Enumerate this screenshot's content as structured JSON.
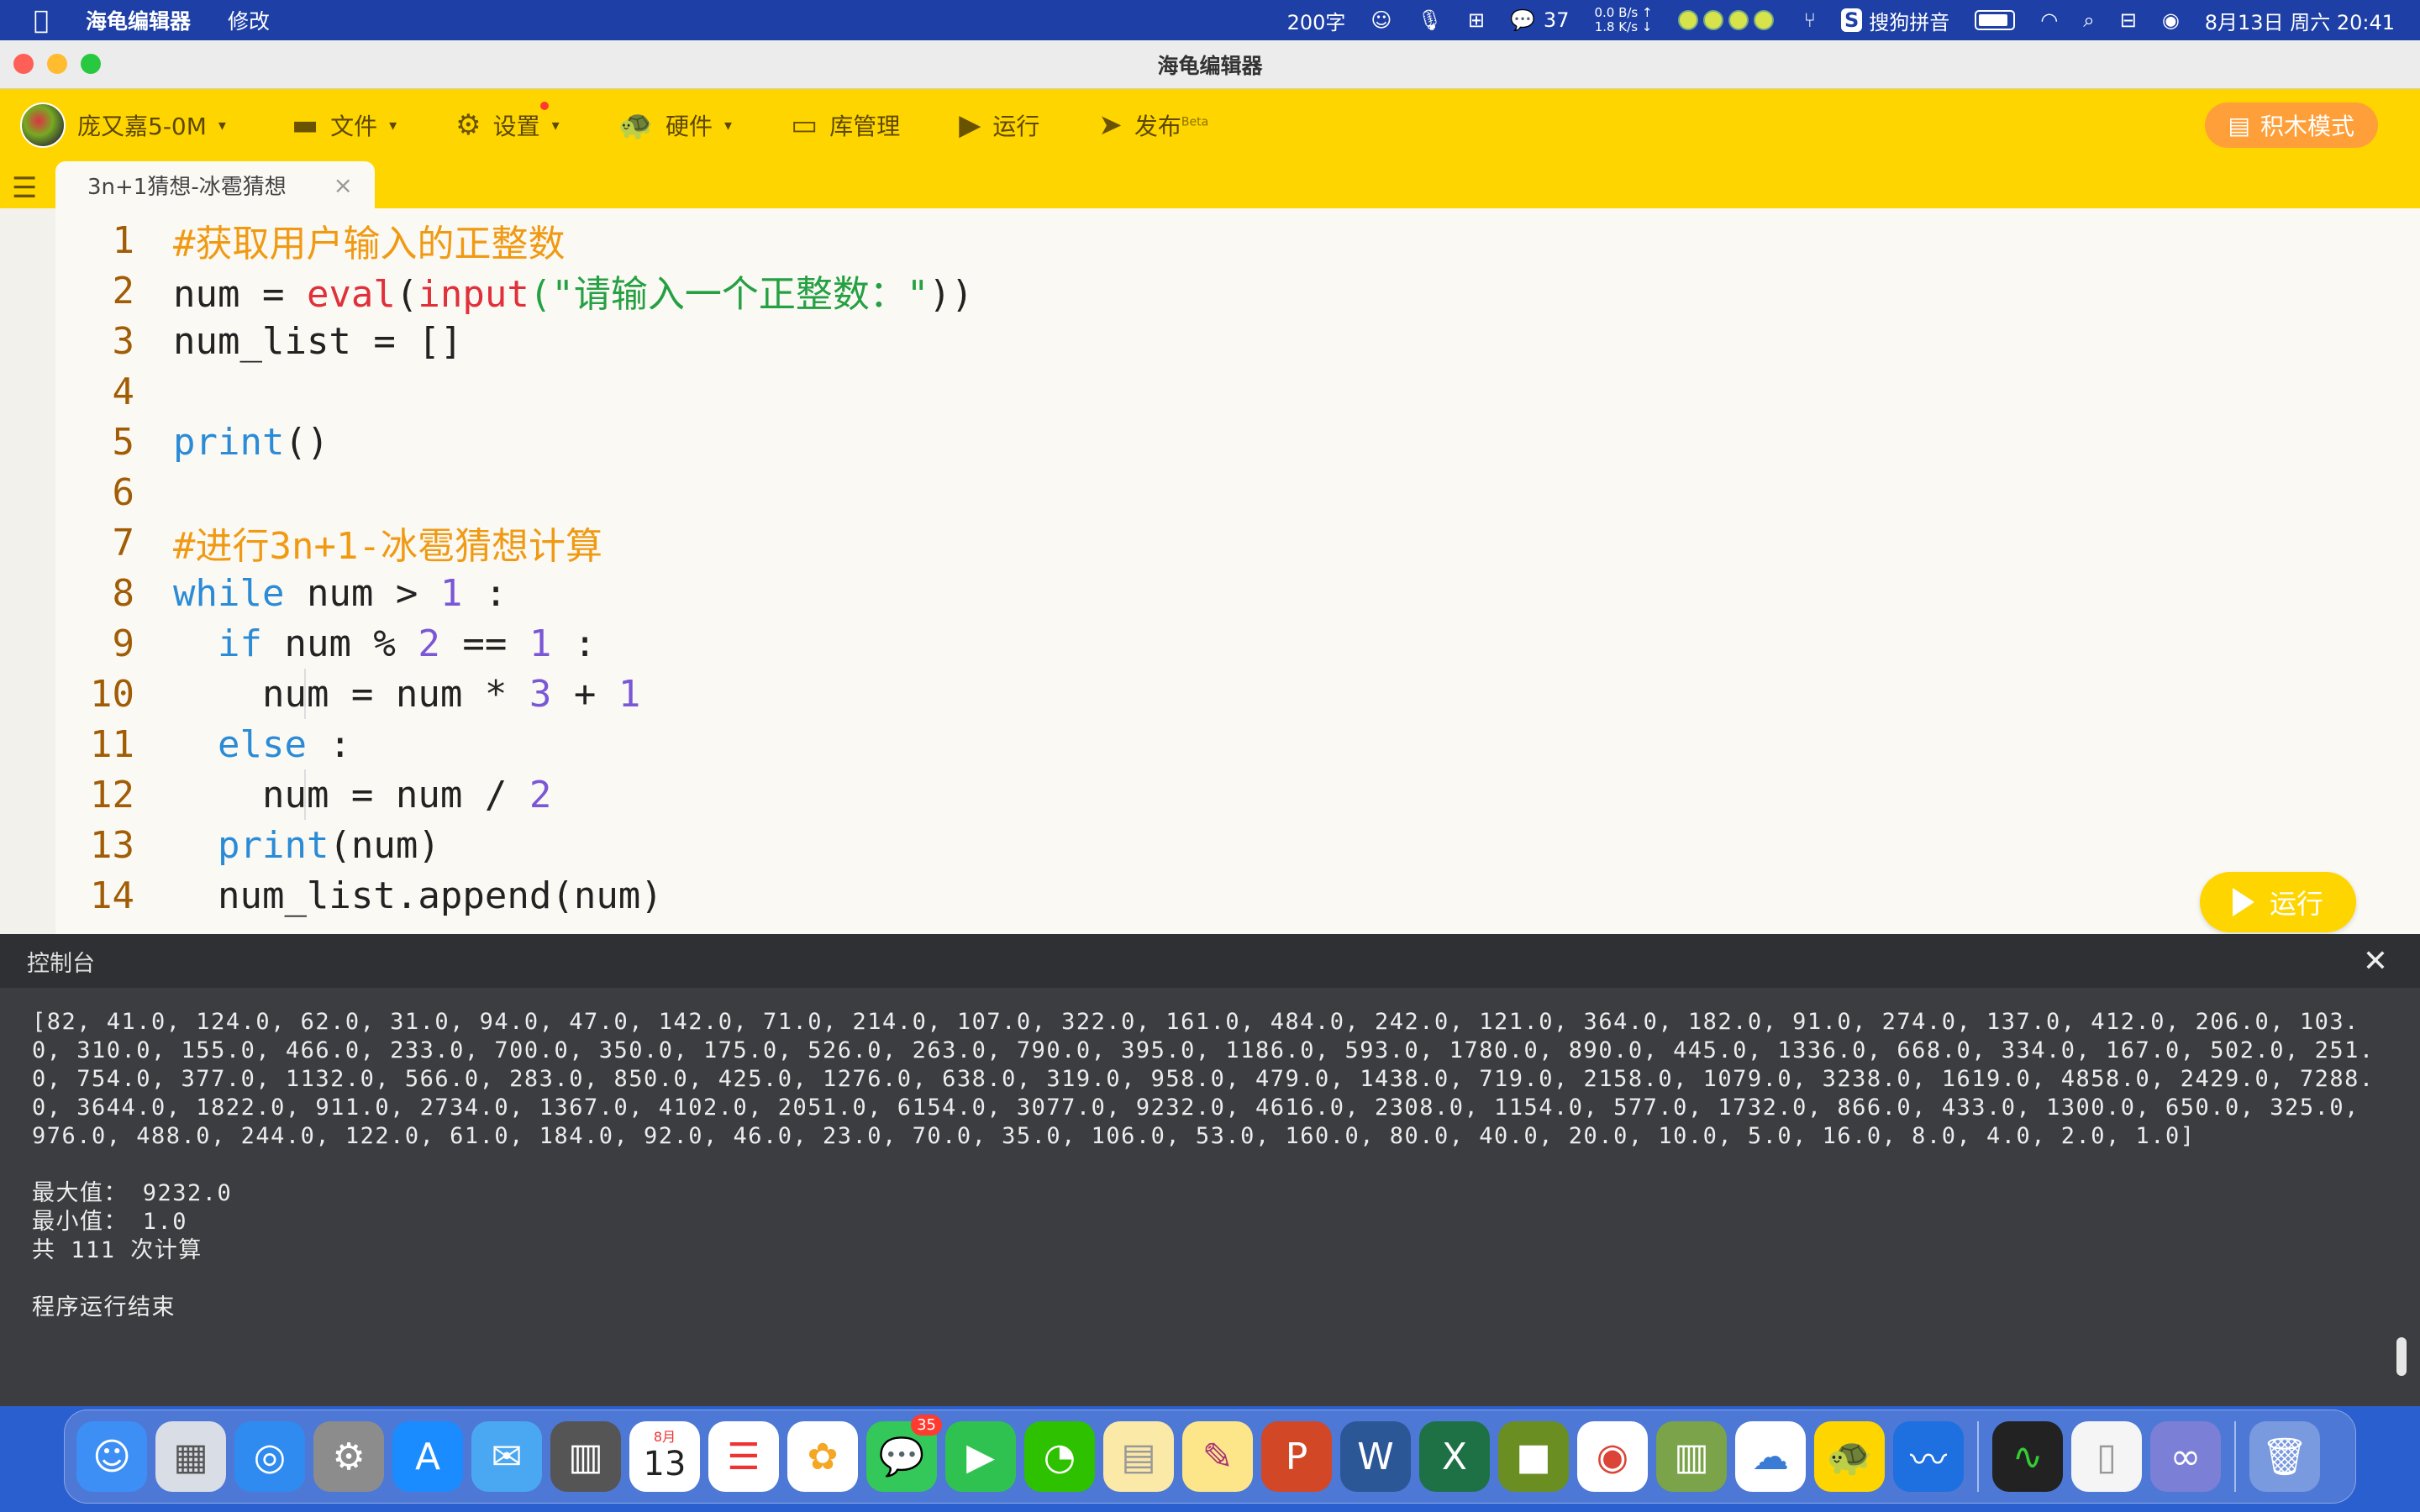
{
  "menubar": {
    "app_name": "海龟编辑器",
    "menu_edit": "修改",
    "word_count": "200字",
    "wechat_count": "37",
    "net_up": "0.0 B/s ↑",
    "net_down": "1.8 K/s ↓",
    "input_method": "搜狗拼音",
    "datetime": "8月13日 周六  20:41"
  },
  "window": {
    "title": "海龟编辑器"
  },
  "toolbar": {
    "user": "庞又嘉5-0M",
    "file": "文件",
    "settings": "设置",
    "hardware": "硬件",
    "library": "库管理",
    "run": "运行",
    "publish": "发布",
    "publish_badge": "Beta",
    "block_mode": "积木模式"
  },
  "tabs": [
    {
      "label": "3n+1猜想-冰雹猜想"
    }
  ],
  "editor": {
    "line_numbers": [
      "1",
      "2",
      "3",
      "4",
      "5",
      "6",
      "7",
      "8",
      "9",
      "10",
      "11",
      "12",
      "13",
      "14"
    ],
    "comment1": "#获取用户输入的正整数",
    "l2_var": "num = ",
    "l2_eval": "eval",
    "l2_open": "(",
    "l2_input": "input",
    "l2_str": "(\"请输入一个正整数：\"",
    "l2_close": "))",
    "l3": "num_list = []",
    "l5_print": "print",
    "l5_paren": "()",
    "comment7": "#进行3n+1-冰雹猜想计算",
    "l8_kw": "while",
    "l8_mid": " num > ",
    "l8_num": "1",
    "l8_end": " :",
    "l9_kw": "if",
    "l9_mid": " num % ",
    "l9_n2": "2",
    "l9_eq": " == ",
    "l9_n1": "1",
    "l9_end": " :",
    "l10_a": "num = num * ",
    "l10_n3": "3",
    "l10_plus": " + ",
    "l10_n1": "1",
    "l11_kw": "else",
    "l11_end": " :",
    "l12_a": "num = num / ",
    "l12_n2": "2",
    "l13_print": "print",
    "l13_arg": "(num)",
    "l14": "num_list.append(num)",
    "run_button": "运行"
  },
  "console": {
    "title": "控制台",
    "output": "[82, 41.0, 124.0, 62.0, 31.0, 94.0, 47.0, 142.0, 71.0, 214.0, 107.0, 322.0, 161.0, 484.0, 242.0, 121.0, 364.0, 182.0, 91.0, 274.0, 137.0, 412.0, 206.0, 103.0, 310.0, 155.0, 466.0, 233.0, 700.0, 350.0, 175.0, 526.0, 263.0, 790.0, 395.0, 1186.0, 593.0, 1780.0, 890.0, 445.0, 1336.0, 668.0, 334.0, 167.0, 502.0, 251.0, 754.0, 377.0, 1132.0, 566.0, 283.0, 850.0, 425.0, 1276.0, 638.0, 319.0, 958.0, 479.0, 1438.0, 719.0, 2158.0, 1079.0, 3238.0, 1619.0, 4858.0, 2429.0, 7288.0, 3644.0, 1822.0, 911.0, 2734.0, 1367.0, 4102.0, 2051.0, 6154.0, 3077.0, 9232.0, 4616.0, 2308.0, 1154.0, 577.0, 1732.0, 866.0, 433.0, 1300.0, 650.0, 325.0, 976.0, 488.0, 244.0, 122.0, 61.0, 184.0, 92.0, 46.0, 23.0, 70.0, 35.0, 106.0, 53.0, 160.0, 80.0, 40.0, 20.0, 10.0, 5.0, 16.0, 8.0, 4.0, 2.0, 1.0]",
    "max_line": "最大值： 9232.0",
    "min_line": "最小值： 1.0",
    "count_line": "共 111 次计算",
    "end_line": "程序运行结束"
  },
  "dock": {
    "calendar_month": "8月",
    "calendar_day": "13",
    "messages_badge": "35"
  },
  "colors": {
    "toolbar_bg": "#ffd500",
    "console_bg": "#3b3d40",
    "comment": "#f09a13",
    "keyword": "#2b8bd6",
    "string": "#25a042",
    "number": "#7a57d6"
  }
}
